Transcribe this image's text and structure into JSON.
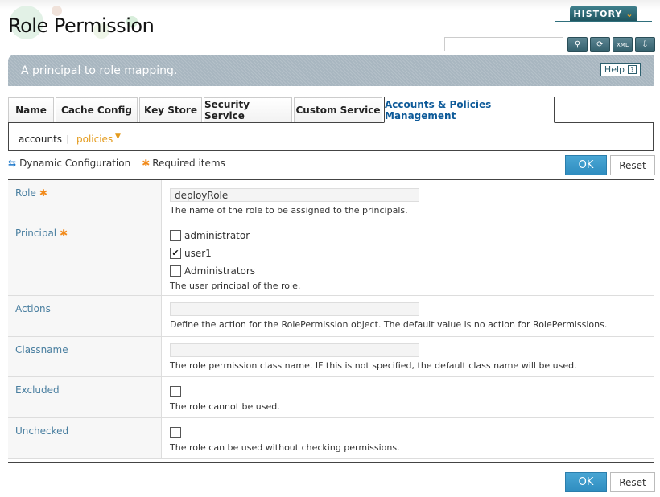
{
  "header": {
    "title": "Role Permission",
    "history_label": "HISTORY",
    "search": {
      "value": "",
      "placeholder": ""
    },
    "toolbar": [
      {
        "name": "search-icon",
        "glyph": "🔍"
      },
      {
        "name": "refresh-icon",
        "glyph": "⟳"
      },
      {
        "name": "xml-export-icon",
        "glyph": "XML"
      },
      {
        "name": "document-download-icon",
        "glyph": "⇩"
      }
    ]
  },
  "banner": {
    "description": "A principal to role mapping.",
    "help_label": "Help",
    "help_icon": "?"
  },
  "tabs": [
    {
      "label": "Name",
      "active": false
    },
    {
      "label": "Cache Config",
      "active": false
    },
    {
      "label": "Key Store",
      "active": false
    },
    {
      "label": "Security Service",
      "active": false
    },
    {
      "label": "Custom Service",
      "active": false
    },
    {
      "label": "Accounts & Policies Management",
      "active": true
    }
  ],
  "subnav": {
    "accounts": "accounts",
    "policies": "policies",
    "separator": "|",
    "dropdown_glyph": "▼"
  },
  "info": {
    "dynamic_config": "Dynamic Configuration",
    "required_items": "Required items",
    "dynamic_glyph": "⇆",
    "required_glyph": "✱"
  },
  "buttons": {
    "ok": "OK",
    "reset": "Reset"
  },
  "form": {
    "role": {
      "label": "Role",
      "required": true,
      "value": "deployRole",
      "description": "The name of the role to be assigned to the principals."
    },
    "principal": {
      "label": "Principal",
      "required": true,
      "options": [
        {
          "label": "administrator",
          "checked": false
        },
        {
          "label": "user1",
          "checked": true
        },
        {
          "label": "Administrators",
          "checked": false
        }
      ],
      "description": "The user principal of the role."
    },
    "actions": {
      "label": "Actions",
      "value": "",
      "description": "Define the action for the RolePermission object. The default value is no action for RolePermissions."
    },
    "classname": {
      "label": "Classname",
      "value": "",
      "description": "The role permission class name. IF this is not specified, the default class name will be used."
    },
    "excluded": {
      "label": "Excluded",
      "checked": false,
      "description": "The role cannot be used."
    },
    "unchecked": {
      "label": "Unchecked",
      "checked": false,
      "description": "The role can be used without checking permissions."
    }
  },
  "colors": {
    "accent_blue": "#0d5a99",
    "required_orange": "#f18a1b",
    "ok_button": "#3a98c9",
    "label_blue": "#4a7fa0"
  }
}
